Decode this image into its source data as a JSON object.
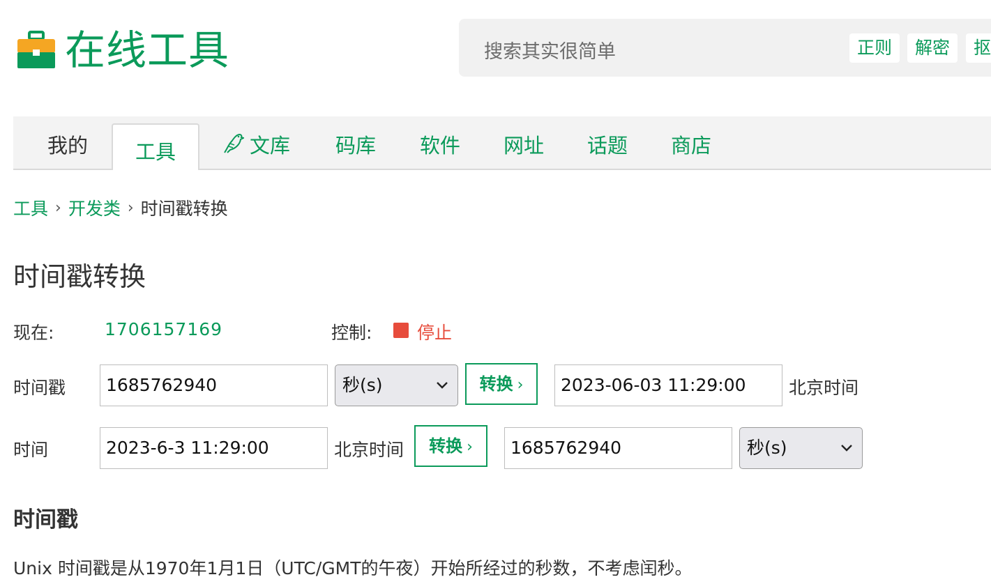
{
  "header": {
    "logo_text": "在线工具",
    "search_placeholder": "搜索其实很简单",
    "quick_tags": [
      "正则",
      "解密",
      "抠"
    ]
  },
  "nav": {
    "tabs": [
      "我的",
      "工具",
      "文库",
      "码库",
      "软件",
      "网址",
      "话题",
      "商店"
    ],
    "active_tab": "工具"
  },
  "breadcrumb": {
    "items": [
      "工具",
      "开发类"
    ],
    "current": "时间戳转换",
    "separator": "›"
  },
  "page": {
    "title": "时间戳转换"
  },
  "now_row": {
    "now_label": "现在:",
    "now_value": "1706157169",
    "control_label": "控制:",
    "stop_label": "停止",
    "stop_color": "#e74c3c"
  },
  "timestamp_row": {
    "label": "时间戳",
    "input_value": "1685762940",
    "unit_selected": "秒(s)",
    "convert_label": "转换",
    "result_value": "2023-06-03 11:29:00",
    "timezone_label": "北京时间"
  },
  "time_row": {
    "label": "时间",
    "input_value": "2023-6-3 11:29:00",
    "timezone_label": "北京时间",
    "convert_label": "转换",
    "result_value": "1685762940",
    "unit_selected": "秒(s)"
  },
  "info": {
    "heading": "时间戳",
    "description": "Unix 时间戳是从1970年1月1日（UTC/GMT的午夜）开始所经过的秒数，不考虑闰秒。"
  },
  "colors": {
    "brand": "#0b9a5a",
    "stop": "#e74c3c",
    "search_bg": "#f1f1f1",
    "nav_bg": "#f3f3f3"
  },
  "icons": [
    "toolbox-icon",
    "bird-icon",
    "chevron-down-icon",
    "stop-icon"
  ]
}
